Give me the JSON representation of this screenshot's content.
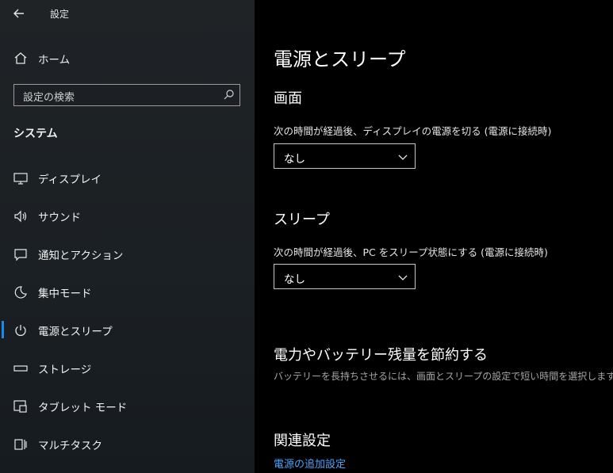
{
  "window": {
    "title": "設定"
  },
  "sidebar": {
    "home_label": "ホーム",
    "search_placeholder": "設定の検索",
    "section_title": "システム",
    "items": [
      {
        "label": "ディスプレイ",
        "icon": "monitor-icon"
      },
      {
        "label": "サウンド",
        "icon": "speaker-icon"
      },
      {
        "label": "通知とアクション",
        "icon": "message-icon"
      },
      {
        "label": "集中モード",
        "icon": "moon-icon"
      },
      {
        "label": "電源とスリープ",
        "icon": "power-icon",
        "selected": true
      },
      {
        "label": "ストレージ",
        "icon": "storage-icon"
      },
      {
        "label": "タブレット モード",
        "icon": "tablet-mode-icon"
      },
      {
        "label": "マルチタスク",
        "icon": "multitask-icon"
      }
    ]
  },
  "main": {
    "title": "電源とスリープ",
    "screen": {
      "heading": "画面",
      "label": "次の時間が経過後、ディスプレイの電源を切る (電源に接続時)",
      "value": "なし"
    },
    "sleep": {
      "heading": "スリープ",
      "label": "次の時間が経過後、PC をスリープ状態にする (電源に接続時)",
      "value": "なし"
    },
    "battery": {
      "heading": "電力やバッテリー残量を節約する",
      "description": "バッテリーを長持ちさせるには、画面とスリープの設定で短い時間を選択します。"
    },
    "related": {
      "heading": "関連設定",
      "link": "電源の追加設定"
    }
  },
  "colors": {
    "accent": "#1e88e5",
    "link": "#4aa3ff",
    "sidebar_bg": "#1b2024",
    "main_bg": "#000000"
  }
}
